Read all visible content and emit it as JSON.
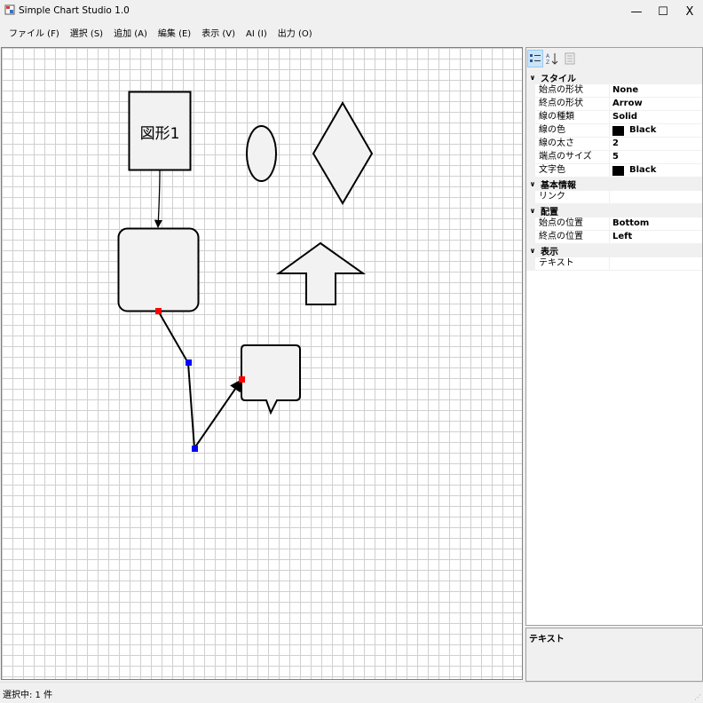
{
  "window": {
    "title": "Simple Chart Studio 1.0",
    "controls": {
      "minimize": "—",
      "maximize": "☐",
      "close": "X"
    }
  },
  "menu": [
    {
      "label": "ファイル (F)"
    },
    {
      "label": "選択 (S)"
    },
    {
      "label": "追加 (A)"
    },
    {
      "label": "編集 (E)"
    },
    {
      "label": "表示 (V)"
    },
    {
      "label": "AI (I)"
    },
    {
      "label": "出力 (O)"
    }
  ],
  "canvas": {
    "shapes": [
      {
        "type": "rectangle",
        "text": "図形1"
      },
      {
        "type": "ellipse",
        "text": ""
      },
      {
        "type": "diamond",
        "text": ""
      },
      {
        "type": "rounded-rectangle",
        "text": ""
      },
      {
        "type": "up-arrow",
        "text": ""
      },
      {
        "type": "speech-bubble",
        "text": ""
      }
    ],
    "connectors": [
      {
        "from": "rectangle",
        "to": "rounded-rectangle",
        "end_shape": "Arrow"
      },
      {
        "from": "rounded-rectangle",
        "to": "speech-bubble",
        "end_shape": "Arrow",
        "selected": true
      }
    ]
  },
  "property_grid": {
    "toolbar": {
      "categorized_icon": "categorized-icon",
      "alphabetical_icon": "sort-az-icon",
      "pages_icon": "property-pages-icon"
    },
    "categories": [
      {
        "name": "スタイル",
        "properties": [
          {
            "name": "始点の形状",
            "value": "None"
          },
          {
            "name": "終点の形状",
            "value": "Arrow"
          },
          {
            "name": "線の種類",
            "value": "Solid"
          },
          {
            "name": "線の色",
            "value": "Black",
            "color": "#000000"
          },
          {
            "name": "線の太さ",
            "value": "2"
          },
          {
            "name": "端点のサイズ",
            "value": "5"
          },
          {
            "name": "文字色",
            "value": "Black",
            "color": "#000000"
          }
        ]
      },
      {
        "name": "基本情報",
        "properties": [
          {
            "name": "リンク",
            "value": ""
          }
        ]
      },
      {
        "name": "配置",
        "properties": [
          {
            "name": "始点の位置",
            "value": "Bottom"
          },
          {
            "name": "終点の位置",
            "value": "Left"
          }
        ]
      },
      {
        "name": "表示",
        "properties": [
          {
            "name": "テキスト",
            "value": ""
          }
        ]
      }
    ],
    "description_title": "テキスト"
  },
  "status": {
    "text": "選択中: 1 件"
  },
  "colors": {
    "shape_fill": "#f2f2f2",
    "handle_end": "#ff0000",
    "handle_mid": "#0000ff",
    "grid": "#d0d0d0"
  }
}
